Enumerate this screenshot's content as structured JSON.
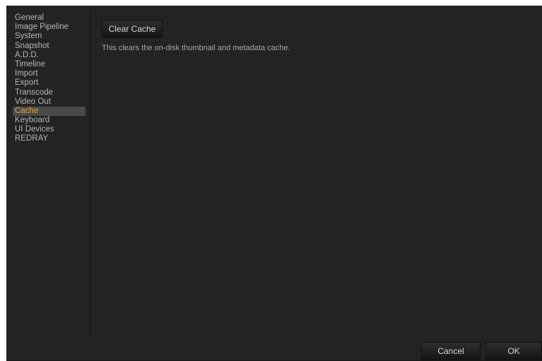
{
  "sidebar": {
    "items": [
      {
        "label": "General"
      },
      {
        "label": "Image Pipeline"
      },
      {
        "label": "System"
      },
      {
        "label": "Snapshot"
      },
      {
        "label": "A.D.D."
      },
      {
        "label": "Timeline"
      },
      {
        "label": "Import"
      },
      {
        "label": "Export"
      },
      {
        "label": "Transcode"
      },
      {
        "label": "Video Out"
      },
      {
        "label": "Cache"
      },
      {
        "label": "Keyboard"
      },
      {
        "label": "UI Devices"
      },
      {
        "label": "REDRAY"
      }
    ],
    "selected": "Cache"
  },
  "cache_panel": {
    "clear_button_label": "Clear Cache",
    "description": "This clears the on-disk thumbnail and metadata cache."
  },
  "footer": {
    "cancel_label": "Cancel",
    "ok_label": "OK"
  },
  "colors": {
    "background": "#232323",
    "selected_text": "#e2a83c",
    "selected_bg": "#4a4a4a"
  }
}
